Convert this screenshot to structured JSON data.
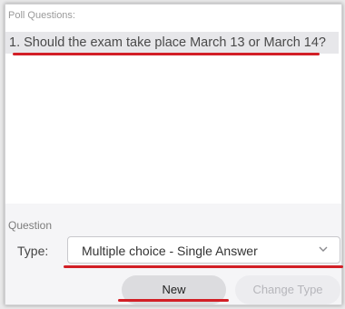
{
  "poll": {
    "header": "Poll Questions:",
    "question": "1.  Should the exam take place March 13 or March 14?"
  },
  "form": {
    "section_label": "Question",
    "type_label": "Type:",
    "type_value": "Multiple choice - Single Answer"
  },
  "buttons": {
    "new_label": "New",
    "change_type_label": "Change Type"
  },
  "annotation": {
    "underline_color": "#d21f26"
  }
}
